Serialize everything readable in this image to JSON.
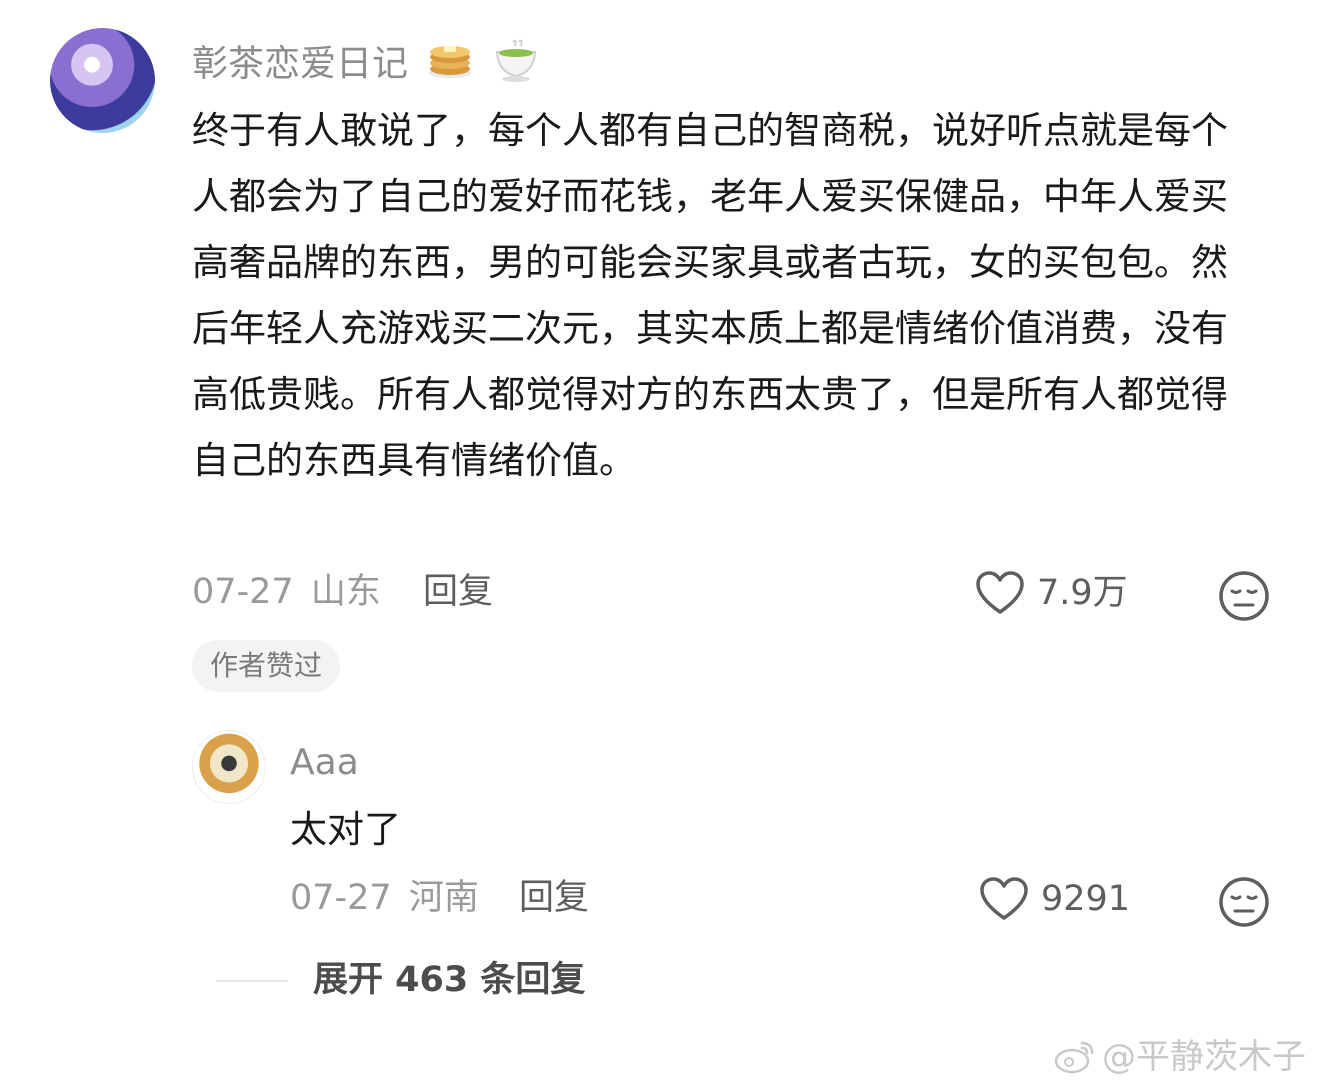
{
  "comment": {
    "username": "彰茶恋爱日记",
    "emoji_1": "pancakes-icon",
    "emoji_2": "green-tea-icon",
    "text": "终于有人敢说了，每个人都有自己的智商税，说好听点就是每个人都会为了自己的爱好而花钱，老年人爱买保健品，中年人爱买高奢品牌的东西，男的可能会买家具或者古玩，女的买包包。然后年轻人充游戏买二次元，其实本质上都是情绪价值消费，没有高低贵贱。所有人都觉得对方的东西太贵了，但是所有人都觉得自己的东西具有情绪价值。",
    "date": "07-27",
    "location": "山东",
    "reply_label": "回复",
    "like_count": "7.9万",
    "badge": "作者赞过"
  },
  "reply": {
    "username": "Aaa",
    "text": "太对了",
    "date": "07-27",
    "location": "河南",
    "reply_label": "回复",
    "like_count": "9291"
  },
  "expand": {
    "label": "展开 463 条回复"
  },
  "watermark": {
    "text": "@平静茨木子"
  },
  "colors": {
    "text": "#1a1a1a",
    "muted": "#9a9a9a",
    "secondary": "#5e5e5e",
    "badge_bg": "#f3f3f3"
  }
}
